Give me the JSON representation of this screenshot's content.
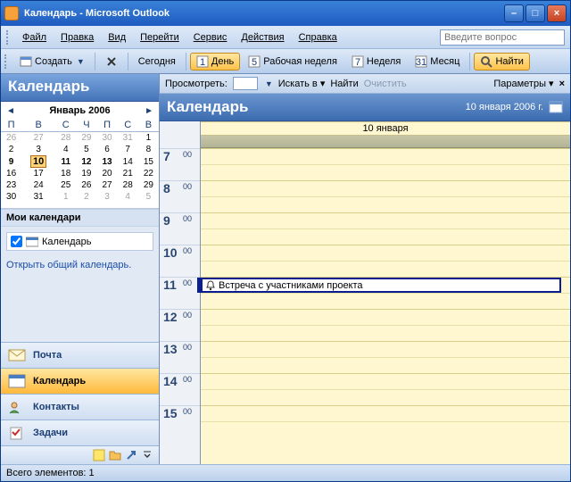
{
  "window": {
    "title": "Календарь - Microsoft Outlook"
  },
  "menu": {
    "file": "Файл",
    "edit": "Правка",
    "view": "Вид",
    "go": "Перейти",
    "service": "Сервис",
    "actions": "Действия",
    "help": "Справка",
    "askbox_placeholder": "Введите вопрос"
  },
  "toolbar": {
    "create": "Создать",
    "today": "Сегодня",
    "day": "День",
    "workweek": "Рабочая неделя",
    "week": "Неделя",
    "month": "Месяц",
    "find": "Найти"
  },
  "search": {
    "view": "Просмотреть:",
    "lookin": "Искать в",
    "find": "Найти",
    "clear": "Очистить",
    "options": "Параметры"
  },
  "nav": {
    "header": "Календарь",
    "month_label": "Январь 2006",
    "dow": [
      "П",
      "В",
      "С",
      "Ч",
      "П",
      "С",
      "В"
    ],
    "grid": [
      [
        {
          "d": 26,
          "dim": true
        },
        {
          "d": 27,
          "dim": true
        },
        {
          "d": 28,
          "dim": true
        },
        {
          "d": 29,
          "dim": true
        },
        {
          "d": 30,
          "dim": true
        },
        {
          "d": 31,
          "dim": true
        },
        {
          "d": 1
        }
      ],
      [
        {
          "d": 2
        },
        {
          "d": 3
        },
        {
          "d": 4
        },
        {
          "d": 5
        },
        {
          "d": 6
        },
        {
          "d": 7
        },
        {
          "d": 8
        }
      ],
      [
        {
          "d": 9,
          "bold": true
        },
        {
          "d": 10,
          "today": true,
          "bold": true
        },
        {
          "d": 11,
          "bold": true
        },
        {
          "d": 12,
          "bold": true
        },
        {
          "d": 13,
          "bold": true
        },
        {
          "d": 14
        },
        {
          "d": 15
        }
      ],
      [
        {
          "d": 16
        },
        {
          "d": 17
        },
        {
          "d": 18
        },
        {
          "d": 19
        },
        {
          "d": 20
        },
        {
          "d": 21
        },
        {
          "d": 22
        }
      ],
      [
        {
          "d": 23
        },
        {
          "d": 24
        },
        {
          "d": 25
        },
        {
          "d": 26
        },
        {
          "d": 27
        },
        {
          "d": 28
        },
        {
          "d": 29
        }
      ],
      [
        {
          "d": 30
        },
        {
          "d": 31
        },
        {
          "d": 1,
          "dim": true
        },
        {
          "d": 2,
          "dim": true
        },
        {
          "d": 3,
          "dim": true
        },
        {
          "d": 4,
          "dim": true
        },
        {
          "d": 5,
          "dim": true
        }
      ]
    ],
    "mycalendars": "Мои календари",
    "calendar_item": "Календарь",
    "open_shared": "Открыть общий календарь.",
    "mail": "Почта",
    "calendar": "Календарь",
    "contacts": "Контакты",
    "tasks": "Задачи"
  },
  "main": {
    "title": "Календарь",
    "datehdr": "10 января 2006 г.",
    "dayhdr": "10 января",
    "hours": [
      "7",
      "8",
      "9",
      "10",
      "11",
      "12",
      "13",
      "14",
      "15"
    ],
    "minutes": "00",
    "appointment": "Встреча с участниками проекта",
    "appointment_slot_index": 8
  },
  "status": {
    "text": "Всего элементов: 1"
  }
}
